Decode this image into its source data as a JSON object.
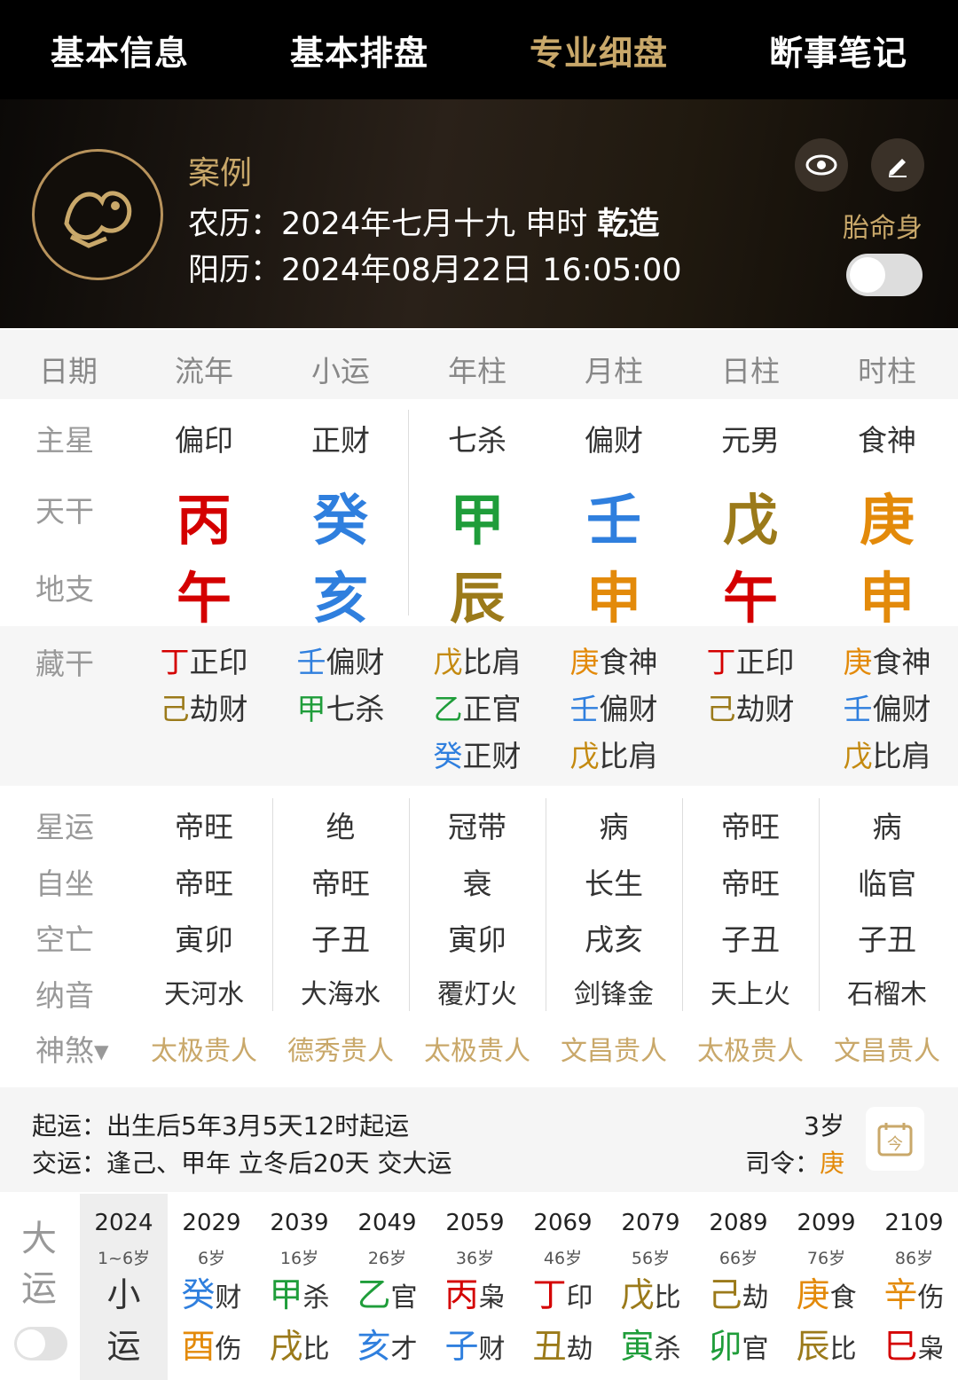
{
  "tabs": [
    "基本信息",
    "基本排盘",
    "专业细盘",
    "断事笔记"
  ],
  "active_tab": 2,
  "profile": {
    "name": "案例",
    "lunar_label": "农历：",
    "lunar_value": "2024年七月十九 申时 ",
    "gender_tag": "乾造",
    "solar_label": "阳历：",
    "solar_value": "2024年08月22日 16:05:00",
    "taiming_label": "胎命身",
    "taiming_on": false
  },
  "icons": {
    "logo": "dragon-emblem-icon",
    "view": "eye-icon",
    "edit": "pencil-icon",
    "calendar": "calendar-icon"
  },
  "columns": [
    "日期",
    "流年",
    "小运",
    "年柱",
    "月柱",
    "日柱",
    "时柱"
  ],
  "rows": {
    "main_star": "主星",
    "tiangan": "天干",
    "dizhi": "地支",
    "canggan": "藏干",
    "xingyun": "星运",
    "zizuo": "自坐",
    "kongwang": "空亡",
    "nayin": "纳音",
    "shensha": "神煞▾"
  },
  "pillars": [
    {
      "star": "偏印",
      "gan": "丙",
      "gan_color": "#d40000",
      "zhi": "午",
      "zhi_color": "#d40000",
      "hidden": [
        [
          "丁",
          "#d40000",
          "正印"
        ],
        [
          "己",
          "#9b7a1a",
          "劫财"
        ]
      ],
      "xingyun": "帝旺",
      "zizuo": "帝旺",
      "kong": "寅卯",
      "nayin": "天河水",
      "shensha": "太极贵人"
    },
    {
      "star": "正财",
      "gan": "癸",
      "gan_color": "#2f7fde",
      "zhi": "亥",
      "zhi_color": "#2f7fde",
      "hidden": [
        [
          "壬",
          "#2f7fde",
          "偏财"
        ],
        [
          "甲",
          "#1f9d3a",
          "七杀"
        ]
      ],
      "xingyun": "绝",
      "zizuo": "帝旺",
      "kong": "子丑",
      "nayin": "大海水",
      "shensha": "德秀贵人"
    },
    {
      "star": "七杀",
      "gan": "甲",
      "gan_color": "#1f9d3a",
      "zhi": "辰",
      "zhi_color": "#9b7a1a",
      "hidden": [
        [
          "戊",
          "#c48a10",
          "比肩"
        ],
        [
          "乙",
          "#1f9d3a",
          "正官"
        ],
        [
          "癸",
          "#2f7fde",
          "正财"
        ]
      ],
      "xingyun": "冠带",
      "zizuo": "衰",
      "kong": "寅卯",
      "nayin": "覆灯火",
      "shensha": "太极贵人"
    },
    {
      "star": "偏财",
      "gan": "壬",
      "gan_color": "#2f7fde",
      "zhi": "申",
      "zhi_color": "#e38a0a",
      "hidden": [
        [
          "庚",
          "#e38a0a",
          "食神"
        ],
        [
          "壬",
          "#2f7fde",
          "偏财"
        ],
        [
          "戊",
          "#c48a10",
          "比肩"
        ]
      ],
      "xingyun": "病",
      "zizuo": "长生",
      "kong": "戌亥",
      "nayin": "剑锋金",
      "shensha": "文昌贵人"
    },
    {
      "star": "元男",
      "gan": "戊",
      "gan_color": "#9b7a1a",
      "zhi": "午",
      "zhi_color": "#d40000",
      "hidden": [
        [
          "丁",
          "#d40000",
          "正印"
        ],
        [
          "己",
          "#9b7a1a",
          "劫财"
        ]
      ],
      "xingyun": "帝旺",
      "zizuo": "帝旺",
      "kong": "子丑",
      "nayin": "天上火",
      "shensha": "太极贵人"
    },
    {
      "star": "食神",
      "gan": "庚",
      "gan_color": "#e38a0a",
      "zhi": "申",
      "zhi_color": "#e38a0a",
      "hidden": [
        [
          "庚",
          "#e38a0a",
          "食神"
        ],
        [
          "壬",
          "#2f7fde",
          "偏财"
        ],
        [
          "戊",
          "#c48a10",
          "比肩"
        ]
      ],
      "xingyun": "病",
      "zizuo": "临官",
      "kong": "子丑",
      "nayin": "石榴木",
      "shensha": "文昌贵人"
    }
  ],
  "qiyun": {
    "label": "起运：",
    "text": "出生后5年3月5天12时起运",
    "age": "3岁"
  },
  "jiaoyun": {
    "label": "交运：",
    "text": "逢己、甲年 立冬后20天 交大运",
    "siling_label": "司令：",
    "siling_value": "庚"
  },
  "dayun": {
    "label1": "大",
    "label2": "运",
    "toggle_on": false,
    "items": [
      {
        "year": "2024",
        "age": "1~6岁",
        "g1": "小",
        "g1c": "#333",
        "s1": "",
        "g2": "运",
        "g2c": "#333",
        "s2": ""
      },
      {
        "year": "2029",
        "age": "6岁",
        "g1": "癸",
        "g1c": "#2f7fde",
        "s1": "财",
        "g2": "酉",
        "g2c": "#e38a0a",
        "s2": "伤"
      },
      {
        "year": "2039",
        "age": "16岁",
        "g1": "甲",
        "g1c": "#1f9d3a",
        "s1": "杀",
        "g2": "戌",
        "g2c": "#9b7a1a",
        "s2": "比"
      },
      {
        "year": "2049",
        "age": "26岁",
        "g1": "乙",
        "g1c": "#1f9d3a",
        "s1": "官",
        "g2": "亥",
        "g2c": "#2f7fde",
        "s2": "才"
      },
      {
        "year": "2059",
        "age": "36岁",
        "g1": "丙",
        "g1c": "#d40000",
        "s1": "枭",
        "g2": "子",
        "g2c": "#2f7fde",
        "s2": "财"
      },
      {
        "year": "2069",
        "age": "46岁",
        "g1": "丁",
        "g1c": "#d40000",
        "s1": "印",
        "g2": "丑",
        "g2c": "#9b7a1a",
        "s2": "劫"
      },
      {
        "year": "2079",
        "age": "56岁",
        "g1": "戊",
        "g1c": "#9b7a1a",
        "s1": "比",
        "g2": "寅",
        "g2c": "#1f9d3a",
        "s2": "杀"
      },
      {
        "year": "2089",
        "age": "66岁",
        "g1": "己",
        "g1c": "#9b7a1a",
        "s1": "劫",
        "g2": "卯",
        "g2c": "#1f9d3a",
        "s2": "官"
      },
      {
        "year": "2099",
        "age": "76岁",
        "g1": "庚",
        "g1c": "#e38a0a",
        "s1": "食",
        "g2": "辰",
        "g2c": "#9b7a1a",
        "s2": "比"
      },
      {
        "year": "2109",
        "age": "86岁",
        "g1": "辛",
        "g1c": "#e38a0a",
        "s1": "伤",
        "g2": "巳",
        "g2c": "#d40000",
        "s2": "枭"
      }
    ]
  }
}
